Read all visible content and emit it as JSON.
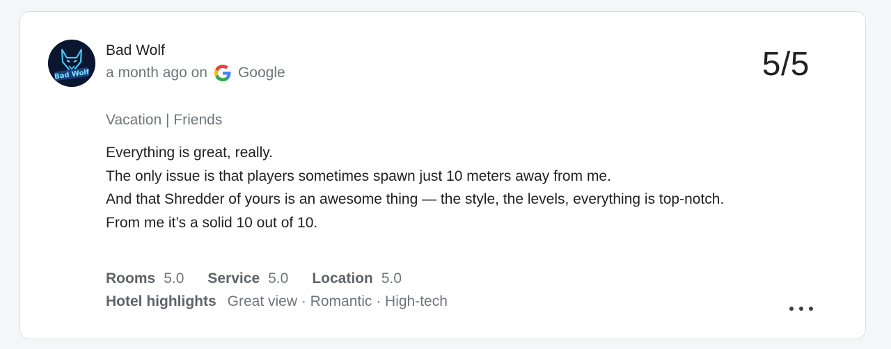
{
  "review": {
    "author": "Bad Wolf",
    "time": "a month ago on",
    "source": "Google",
    "rating": "5/5",
    "trip_type": "Vacation | Friends",
    "text_lines": [
      "Everything is great, really.",
      "The only issue is that players sometimes spawn just 10 meters away from me.",
      "And that Shredder of yours is an awesome thing — the style, the levels, everything is top-notch.",
      "From me it’s a solid 10 out of 10."
    ],
    "avatar_text": "Bad Wolf",
    "sub_ratings": [
      {
        "label": "Rooms",
        "value": "5.0"
      },
      {
        "label": "Service",
        "value": "5.0"
      },
      {
        "label": "Location",
        "value": "5.0"
      }
    ],
    "highlights_label": "Hotel highlights",
    "highlights": "Great view · Romantic · High-tech"
  },
  "icons": {
    "source_logo": "google-g-icon",
    "more": "more-horizontal-icon"
  },
  "colors": {
    "card_bg": "#ffffff",
    "border": "#dadce0",
    "muted_text": "#70757a",
    "primary_text": "#202124"
  }
}
